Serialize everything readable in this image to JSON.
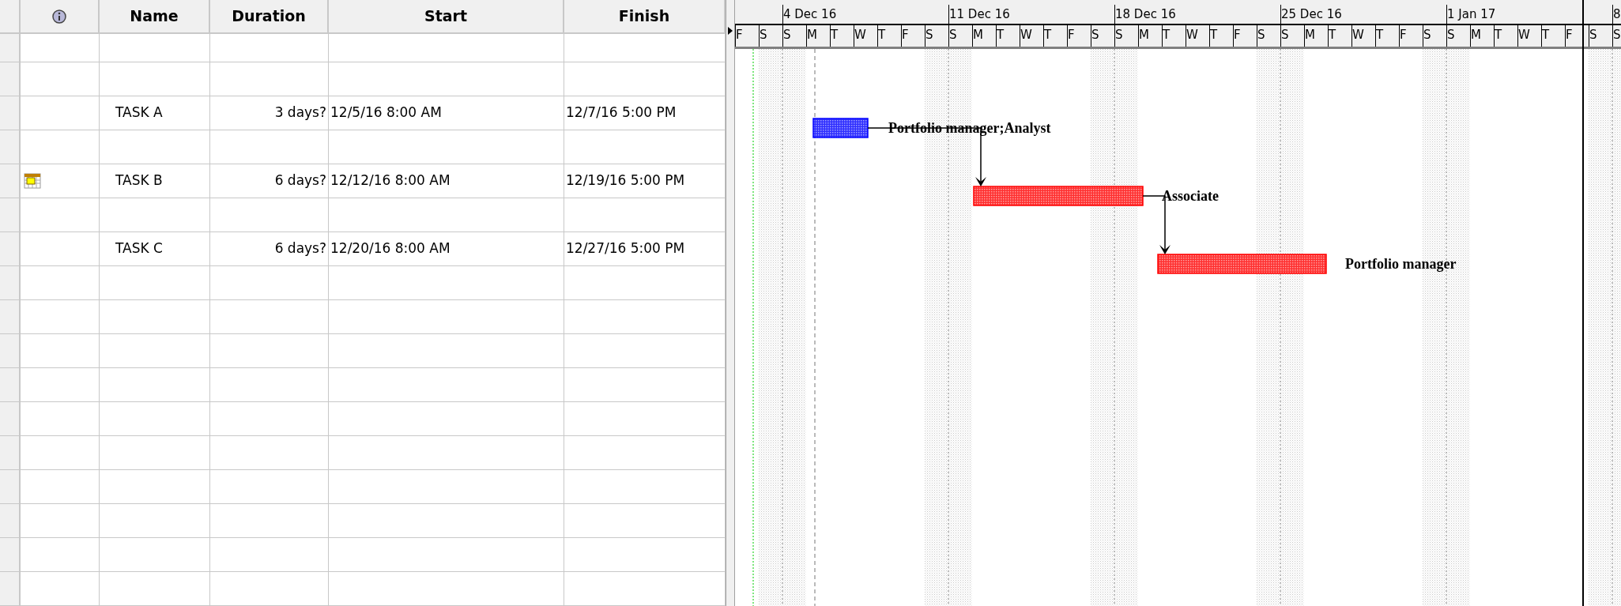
{
  "table": {
    "columns": [
      "Name",
      "Duration",
      "Start",
      "Finish"
    ]
  },
  "tasks": [
    {
      "name": "TASK A",
      "duration": "3 days?",
      "start": "12/5/16 8:00 AM",
      "finish": "12/7/16 5:00 PM",
      "resources": "Portfolio manager;Analyst",
      "critical": false,
      "indicator": false
    },
    {
      "name": "TASK B",
      "duration": "6 days?",
      "start": "12/12/16 8:00 AM",
      "finish": "12/19/16 5:00 PM",
      "resources": "Associate",
      "critical": true,
      "indicator": true
    },
    {
      "name": "TASK C",
      "duration": "6 days?",
      "start": "12/20/16 8:00 AM",
      "finish": "12/27/16 5:00 PM",
      "resources": "Portfolio manager",
      "critical": true,
      "indicator": false
    }
  ],
  "timescale": {
    "weeks": [
      "4 Dec 16",
      "11 Dec 16",
      "18 Dec 16",
      "25 Dec 16",
      "1 Jan 17",
      "8"
    ],
    "days": [
      "F",
      "S",
      "S",
      "M",
      "T",
      "W",
      "T",
      "F",
      "S",
      "S",
      "M",
      "T",
      "W",
      "T",
      "F",
      "S",
      "S",
      "M",
      "T",
      "W",
      "T",
      "F",
      "S",
      "S",
      "M",
      "T",
      "W",
      "T",
      "F",
      "S",
      "S",
      "M",
      "T",
      "W",
      "T",
      "F",
      "S",
      "S"
    ]
  }
}
